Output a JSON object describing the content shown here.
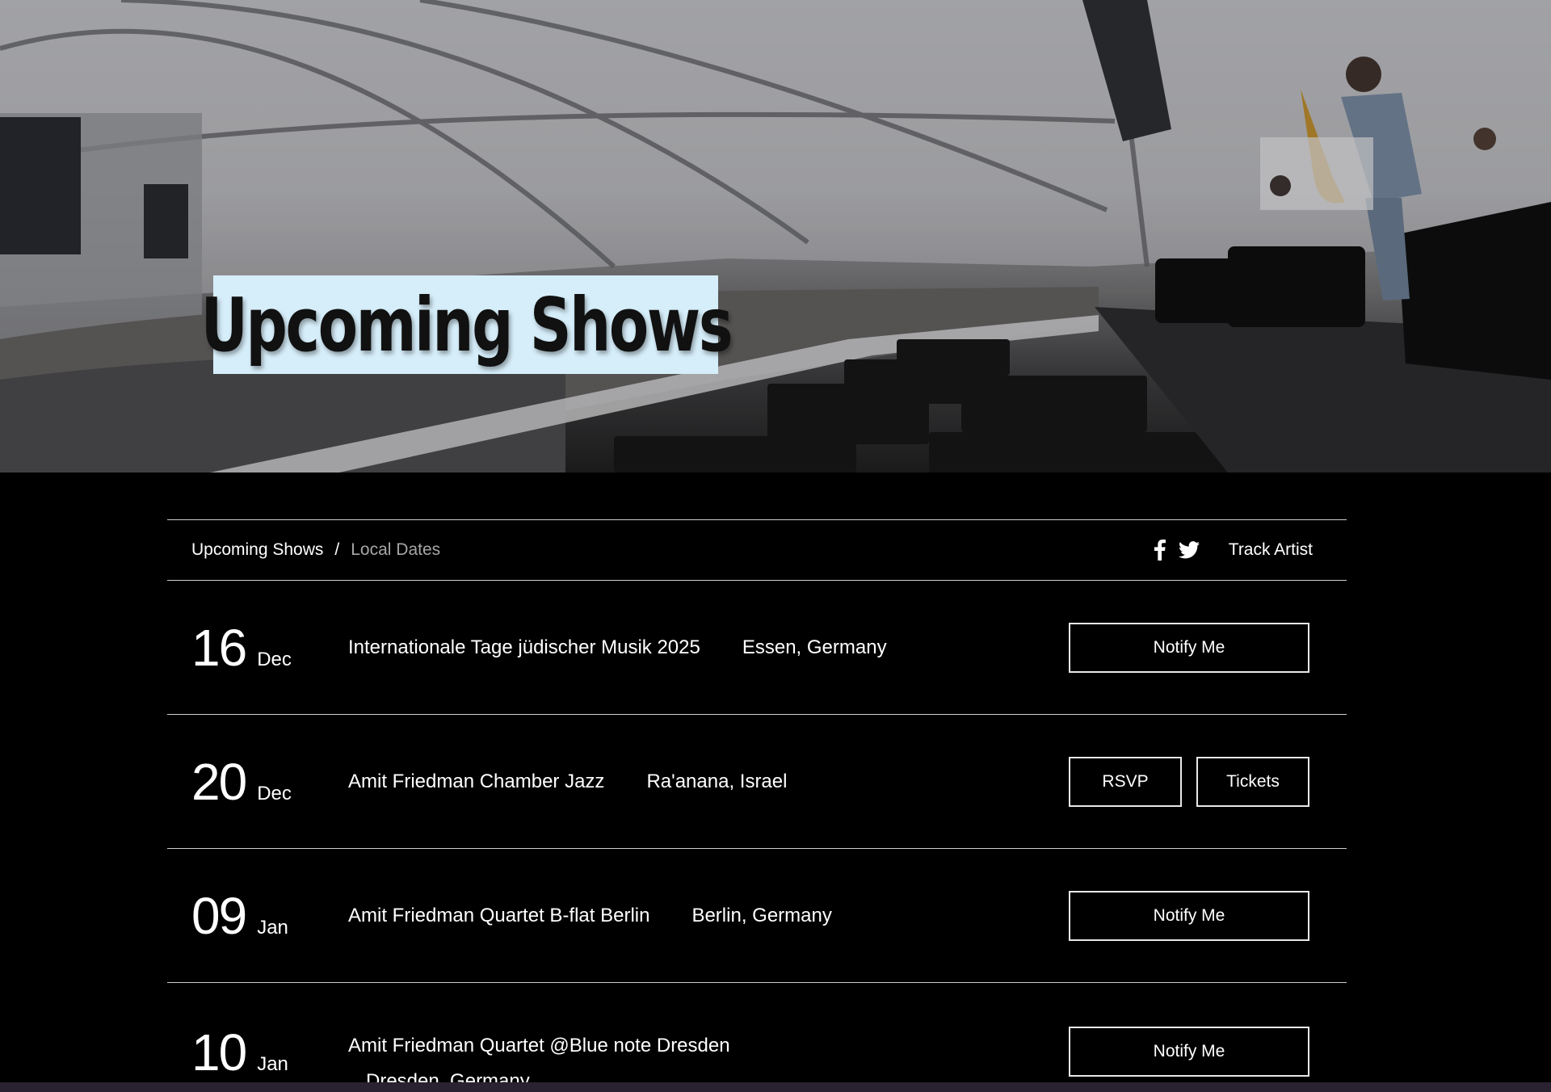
{
  "hero": {
    "title": "Upcoming Shows"
  },
  "toolbar": {
    "breadcrumb_current": "Upcoming Shows",
    "breadcrumb_separator": "/",
    "breadcrumb_filter": "Local Dates",
    "facebook_icon": "facebook-icon",
    "twitter_icon": "twitter-icon",
    "track_label": "Track Artist"
  },
  "shows": [
    {
      "day": "16",
      "month": "Dec",
      "event": "Internationale Tage jüdischer Musik 2025",
      "location": "Essen, Germany",
      "buttons": [
        "Notify Me"
      ]
    },
    {
      "day": "20",
      "month": "Dec",
      "event": "Amit Friedman Chamber Jazz",
      "location": "Ra'anana, Israel",
      "buttons": [
        "RSVP",
        "Tickets"
      ]
    },
    {
      "day": "09",
      "month": "Jan",
      "event": "Amit Friedman Quartet B-flat Berlin",
      "location": "Berlin, Germany",
      "buttons": [
        "Notify Me"
      ]
    },
    {
      "day": "10",
      "month": "Jan",
      "event": "Amit Friedman Quartet @Blue note Dresden",
      "location": "Dresden, Germany",
      "buttons": [
        "Notify Me"
      ]
    }
  ],
  "colors": {
    "background": "#000000",
    "title_box": "#d6eefa",
    "divider": "#cfcfcf",
    "muted_text": "#a6a6a6"
  }
}
